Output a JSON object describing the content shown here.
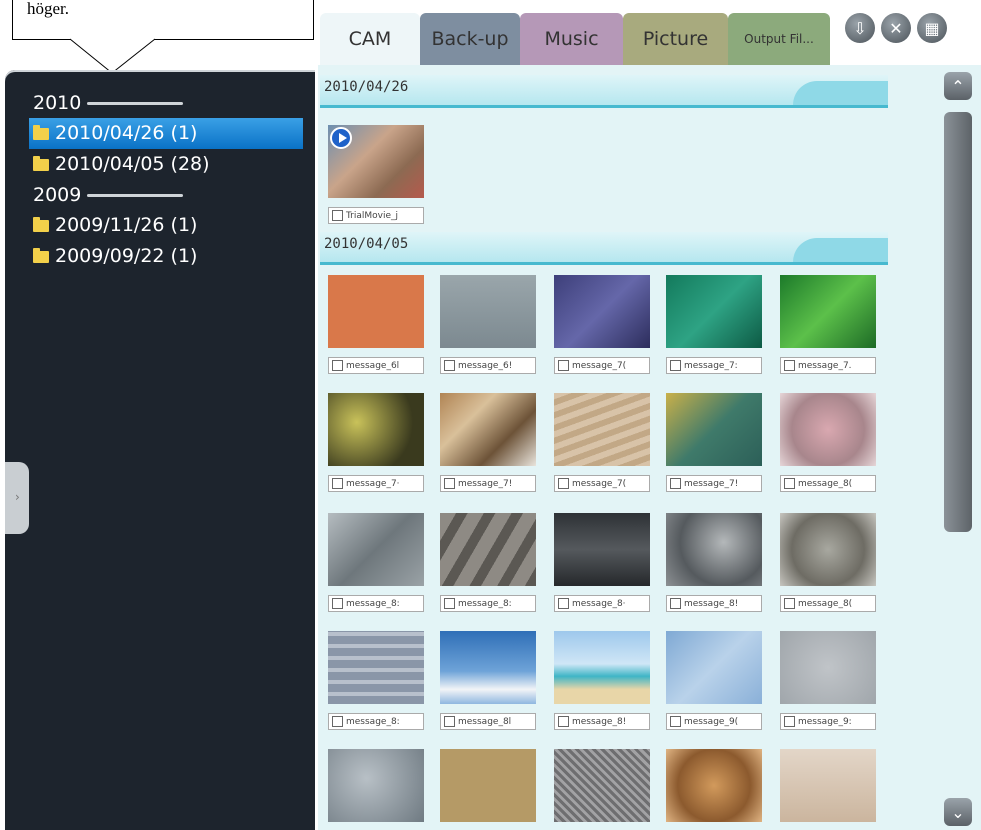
{
  "callout": {
    "text": "höger."
  },
  "tree": {
    "y2010": "2010",
    "f1": "2010/04/26 (1)",
    "f2": "2010/04/05 (28)",
    "y2009": "2009",
    "f3": "2009/11/26 (1)",
    "f4": "2009/09/22 (1)"
  },
  "tabs": {
    "cam": "CAM",
    "backup": "Back-up",
    "music": "Music",
    "picture": "Picture",
    "output": "Output Fil..."
  },
  "sections": {
    "s1": "2010/04/26",
    "s2": "2010/04/05"
  },
  "thumbs": {
    "t0": "TrialMovie_j",
    "t1": "message_6l",
    "t2": "message_6!",
    "t3": "message_7(",
    "t4": "message_7:",
    "t5": "message_7.",
    "t6": "message_7·",
    "t7": "message_7!",
    "t8": "message_7(",
    "t9": "message_7!",
    "t10": "message_8(",
    "t11": "message_8:",
    "t12": "message_8:",
    "t13": "message_8·",
    "t14": "message_8!",
    "t15": "message_8(",
    "t16": "message_8:",
    "t17": "message_8l",
    "t18": "message_8!",
    "t19": "message_9(",
    "t20": "message_9:"
  },
  "colors": {
    "panel": "#1d242d",
    "selected": "#0a72c6",
    "content": "#e3f4f6",
    "header_line": "#47b9cf"
  },
  "icons": {
    "toolbar": [
      "save-icon",
      "close-icon",
      "grid-icon"
    ],
    "scroll": [
      "chevron-up-icon",
      "chevron-down-icon"
    ]
  }
}
